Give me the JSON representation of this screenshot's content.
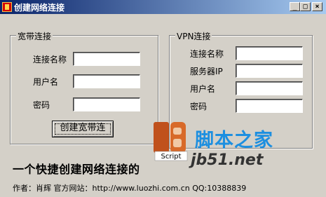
{
  "window": {
    "title": "创建网络连接",
    "min": "_",
    "max": "□",
    "close": "×"
  },
  "broadband": {
    "legend": "宽带连接",
    "name_label": "连接名称",
    "user_label": "用户名",
    "pass_label": "密码",
    "name_value": "",
    "user_value": "",
    "pass_value": "",
    "create_button": "创建宽带连"
  },
  "vpn": {
    "legend": "VPN连接",
    "name_label": "连接名称",
    "server_label": "服务器IP",
    "user_label": "用户名",
    "pass_label": "密码",
    "name_value": "",
    "server_value": "",
    "user_value": "",
    "pass_value": ""
  },
  "description": "一个快捷创建网络连接的",
  "footer": "作者：肖辉  官方网站：http://www.luozhi.com.cn QQ:10388839",
  "watermark": {
    "logo_text": "Script",
    "name": "脚本之家",
    "domain": "jb51.net"
  },
  "colors": {
    "titlebar_start": "#0a246a",
    "titlebar_end": "#a6caf0",
    "face": "#d4d0c8",
    "watermark_blue": "#1d8fe0"
  }
}
